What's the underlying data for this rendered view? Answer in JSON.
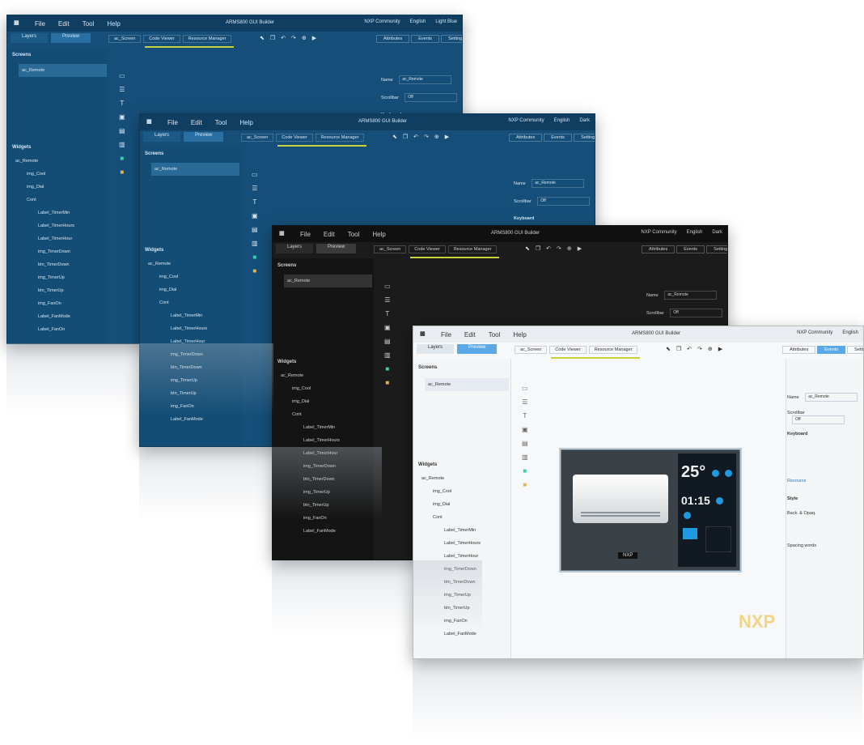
{
  "menu": [
    "File",
    "Edit",
    "Tool",
    "Help"
  ],
  "app_title": "ARMS800 GUI Builder",
  "top_right": {
    "community": "NXP Community",
    "language": "English",
    "theme_blue": "Light Blue",
    "theme_dark": "Dark"
  },
  "left_tabs": [
    "Layers",
    "Preview"
  ],
  "doc_tabs": [
    "ac_Screen",
    "Code Viewer",
    "Resource Manager"
  ],
  "prop_tabs": [
    "Attributes",
    "Events",
    "Settings"
  ],
  "screens_label": "Screens",
  "screen_item": "ac_Remote",
  "widgets_label": "Widgets",
  "widget_tree": [
    "ac_Remote",
    "img_Cool",
    "img_Dial",
    "Cont",
    "Label_TimerMin",
    "Label_TimerHours",
    "Label_TimerHour",
    "img_TimerDown",
    "btn_TimerDown",
    "img_TimerUp",
    "btn_TimerUp",
    "img_FanOn",
    "Label_FanMode",
    "Label_FanOn"
  ],
  "props": {
    "name_label": "Name",
    "name_value": "ac_Remote",
    "scrollbar_label": "Scrollbar",
    "scrollbar_value": "Off",
    "keyboard_label": "Keyboard",
    "style_label": "Style",
    "bgcolor_label": "Back. & Opaq.",
    "spacing_label": "Spacing words",
    "resource_label": "Resource"
  },
  "preview": {
    "temp": "25°",
    "timer": "01:15",
    "brand_strip": "NXP"
  },
  "watermark": "NXP"
}
